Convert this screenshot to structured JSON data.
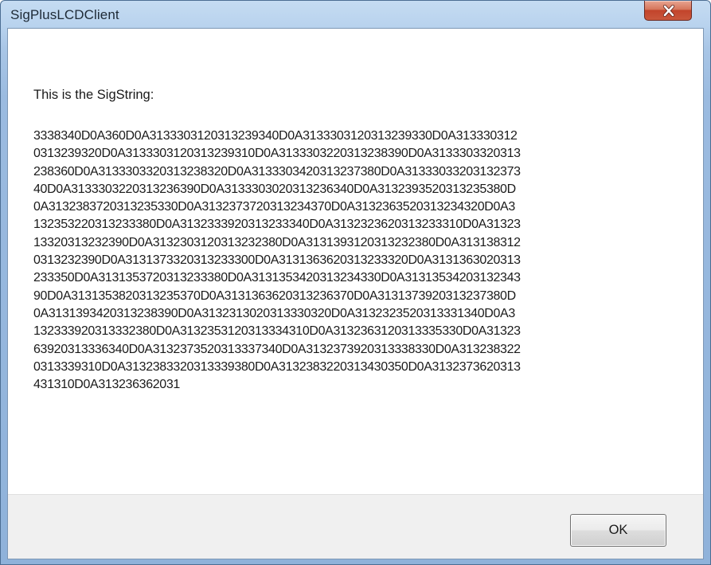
{
  "window": {
    "title": "SigPlusLCDClient"
  },
  "titlebar": {
    "close_icon": "close-x-icon"
  },
  "dialog": {
    "heading": "This is the SigString:",
    "sigstring_lines": [
      "3338340D0A360D0A31333031203132393 40D0A31333031203132393 30D0A313330312",
      "0313239320D0A31333031203132393 10D0A31333032203132383 90D0A3133303320313",
      "238360D0A31333033203132383 20D0A31333034203132373 80D0A313330332031323 73",
      "40D0A31333032203132363 90D0A31333030203132363 40D0A31323935203132353 80D",
      "0A31323837203132353 30D0A31323737203132343 70D0A31323635203132343 20D0A3",
      "132353220313233380D0A31323339203132333 40D0A31323236203132333 10D0A31323",
      "13320313232390D0A31323031203132323 80D0A31313931203132323 80D0A313138312",
      "0313232390D0A31313733203132333 00D0A31313636203132333 20D0A3131363020313",
      "233350D0A31313537203132333 80D0A31313534203132343 30D0A313135342031323 43",
      "90D0A31313538203132353 70D0A31313636203132363 70D0A31313739203132373 80D",
      "0A31313934203132383 90D0A31323130203133303 20D0A31323235203133313 40D0A3",
      "132333920313332380D0A31323531203133343 10D0A31323631203133353 30D0A31323",
      "63920313336340D0A31323735203133373 40D0A31323739203133383 30D0A313238322",
      "0313339310D0A31323833203133393 80D0A31323832203134303 50D0A3132373620313",
      "431310D0A313236362031"
    ]
  },
  "buttons": {
    "ok_label": "OK"
  }
}
